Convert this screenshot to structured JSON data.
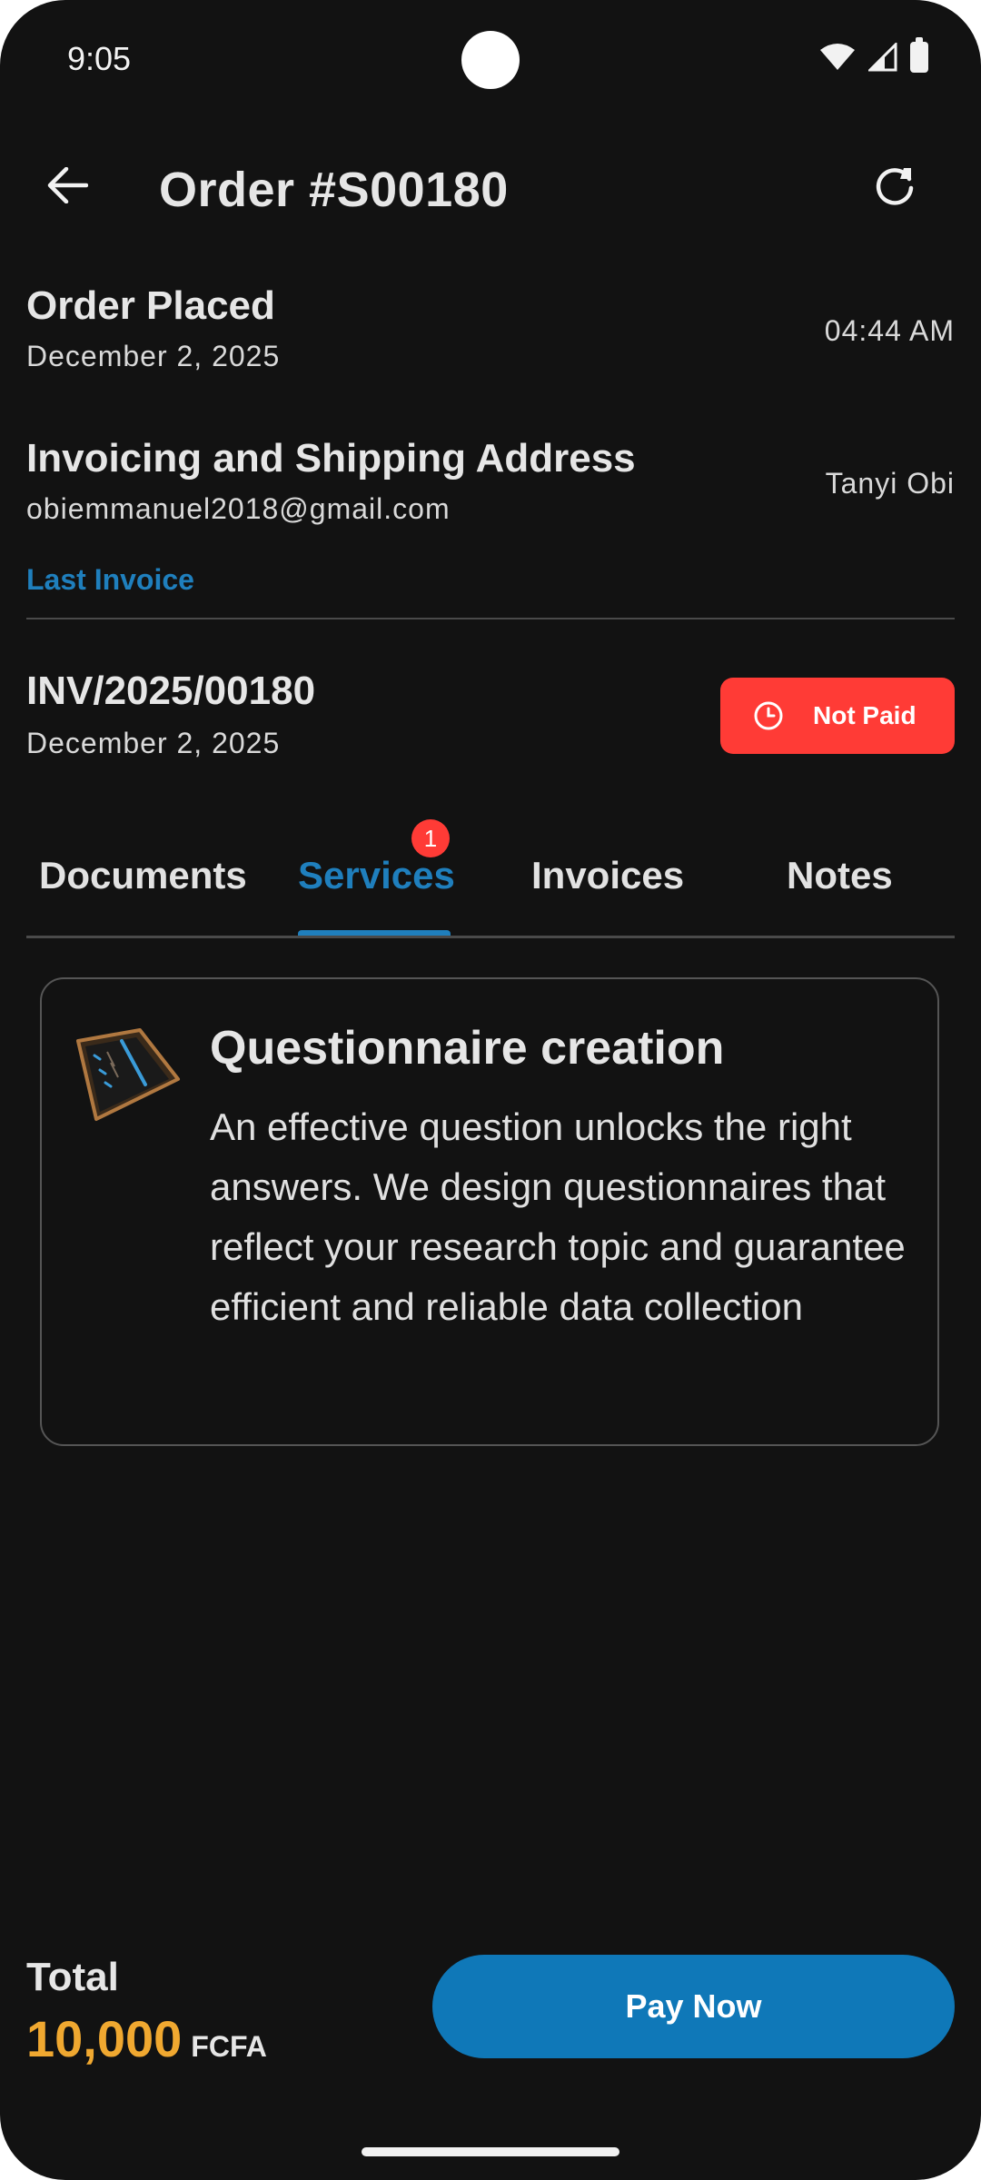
{
  "status_bar": {
    "time": "9:05"
  },
  "header": {
    "title": "Order #S00180"
  },
  "order_placed": {
    "title": "Order Placed",
    "date": "December 2, 2025",
    "time": "04:44 AM"
  },
  "address": {
    "title": "Invoicing and Shipping Address",
    "email": "obiemmanuel2018@gmail.com",
    "name": "Tanyi Obi"
  },
  "last_invoice_link": "Last Invoice",
  "invoice": {
    "number": "INV/2025/00180",
    "date": "December 2, 2025",
    "status": "Not Paid",
    "status_color": "#ff3b36"
  },
  "tabs": [
    {
      "label": "Documents"
    },
    {
      "label": "Services",
      "active": true,
      "badge": "1"
    },
    {
      "label": "Invoices"
    },
    {
      "label": "Notes"
    }
  ],
  "service": {
    "icon": "clipboard-icon",
    "title": "Questionnaire creation",
    "description": "An effective question unlocks the right answers. We design questionnaires that reflect your research topic and guarantee efficient and reliable data collection"
  },
  "footer": {
    "total_label": "Total",
    "amount": "10,000",
    "currency": "FCFA",
    "pay_label": "Pay Now"
  },
  "colors": {
    "background": "#121212",
    "accent": "#1f7fbd",
    "amount": "#f0a830",
    "badge": "#ff3b36"
  }
}
